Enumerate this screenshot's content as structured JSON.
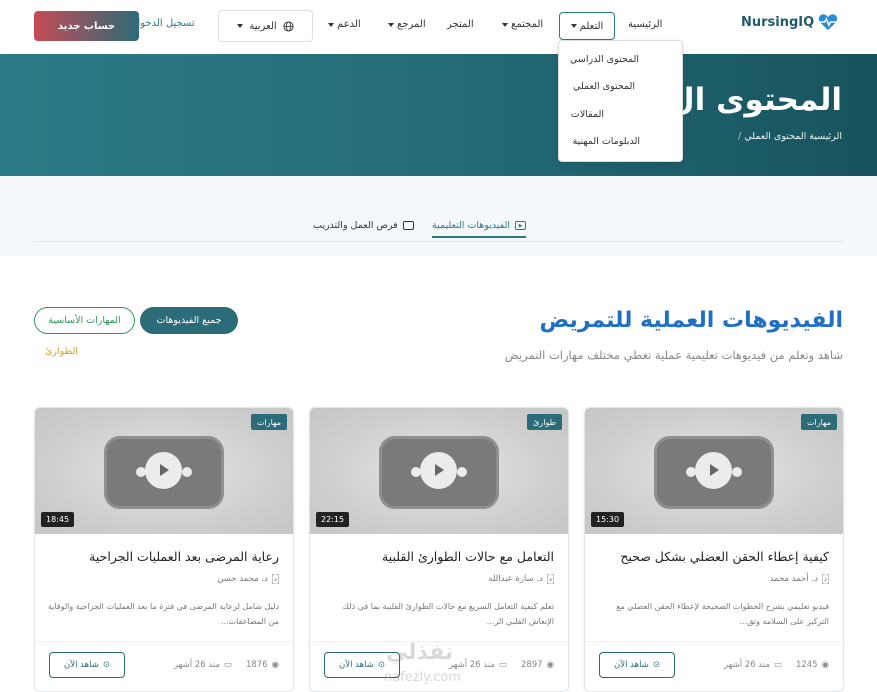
{
  "header": {
    "logo": "NursingIQ",
    "nav": {
      "home": "الرئيسية",
      "learn": "التعلم",
      "community": "المجتمع",
      "store": "المتجر",
      "reference": "المرجع",
      "support": "الدعم"
    },
    "language": "العربية",
    "login": "تسجيل الدخول",
    "signup": "حساب جديد"
  },
  "dropdown": {
    "items": [
      "المحتوى الدراسي",
      "المحتوى العملي",
      "المقالات",
      "الدبلومات المهنية"
    ]
  },
  "hero": {
    "title": "المحتوى ال",
    "breadcrumb": {
      "home": "الرئيسية",
      "current": "المحتوى العملي"
    }
  },
  "tabs": {
    "videos": "الفيديوهات التعليمية",
    "jobs": "فرص العمل والتدريب"
  },
  "section": {
    "title": "الفيديوهات العملية للتمريض",
    "subtitle": "شاهد وتعلم من فيديوهات تعليمية عملية تغطي مختلف مهارات التمريض"
  },
  "filters": {
    "all": "جميع الفيديوهات",
    "basic": "المهارات الأساسية",
    "emergency": "الطوارئ"
  },
  "cards": [
    {
      "badge": "مهارات",
      "duration": "15:30",
      "title": "كيفية إعطاء الحقن العضلي بشكل صحيح",
      "author": "د. أحمد محمد",
      "avatar_alt": "د",
      "description": "فيديو تعليمي يشرح الخطوات الصحيحة لإعطاء الحقن العضلي مع التركيز على السلامة وتق...",
      "date": "منذ 26 أشهر",
      "views": "1245",
      "watch": "شاهد الآن"
    },
    {
      "badge": "طوارئ",
      "duration": "22:15",
      "title": "التعامل مع حالات الطوارئ القلبية",
      "author": "د. سارة عبدالله",
      "avatar_alt": "د",
      "description": "تعلم كيفية التعامل السريع مع حالات الطوارئ القلبية بما في ذلك الإنعاش القلبي الر...",
      "date": "منذ 26 أشهر",
      "views": "2897",
      "watch": "شاهد الآن"
    },
    {
      "badge": "مهارات",
      "duration": "18:45",
      "title": "رعاية المرضى بعد العمليات الجراحية",
      "author": "د. محمد حسن",
      "avatar_alt": "د",
      "description": "دليل شامل لرعاية المرضى في فترة ما بعد العمليات الجراحية والوقاية من المضاعفات...",
      "date": "منذ 26 أشهر",
      "views": "1876",
      "watch": "شاهد الآن"
    }
  ],
  "watermark": {
    "arabic": "نفذلي",
    "latin": "nafezly.com"
  },
  "colors": {
    "primary": "#2c6b78",
    "title_blue": "#1f6fc4",
    "green": "#2c9a55",
    "emergency": "#d6a030"
  }
}
